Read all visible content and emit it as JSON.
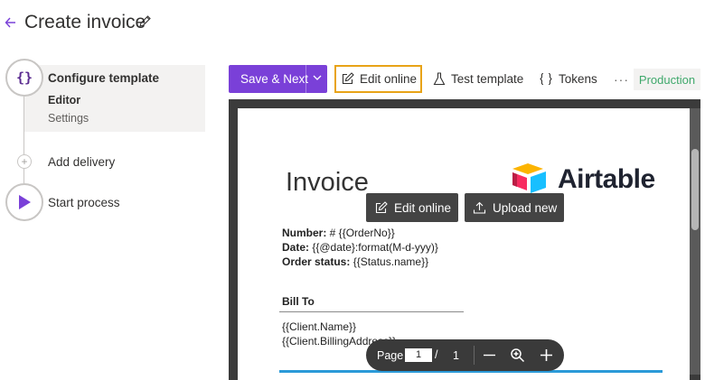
{
  "header": {
    "title": "Create invoice"
  },
  "steps": {
    "configure": {
      "label": "Configure template",
      "substeps": [
        "Editor",
        "Settings"
      ]
    },
    "add_delivery": {
      "label": "Add delivery"
    },
    "start_process": {
      "label": "Start process"
    }
  },
  "toolbar": {
    "save_label": "Save & Next",
    "edit_online_label": "Edit online",
    "test_template_label": "Test template",
    "tokens_label": "Tokens",
    "more_label": "···",
    "environment_label": "Production"
  },
  "document": {
    "title": "Invoice",
    "logo_text": "Airtable",
    "number_label": "Number:",
    "number_value": " # {{OrderNo}}",
    "date_label": "Date:",
    "date_value": " {{@date}:format(M-d-yyy)}",
    "status_label": "Order status:",
    "status_value": " {{Status.name}}",
    "bill_to": "Bill To",
    "client_name": "{{Client.Name}}",
    "client_address": "{{Client.BillingAddress}}"
  },
  "overlay": {
    "edit_online_label": "Edit online",
    "upload_new_label": "Upload new"
  },
  "pager": {
    "page_label": "Page",
    "current_page": "1",
    "separator": "/",
    "total_pages": "1"
  },
  "colors": {
    "accent": "#7a40d8",
    "highlight_border": "#e8a317",
    "production_green": "#3fa86b"
  }
}
